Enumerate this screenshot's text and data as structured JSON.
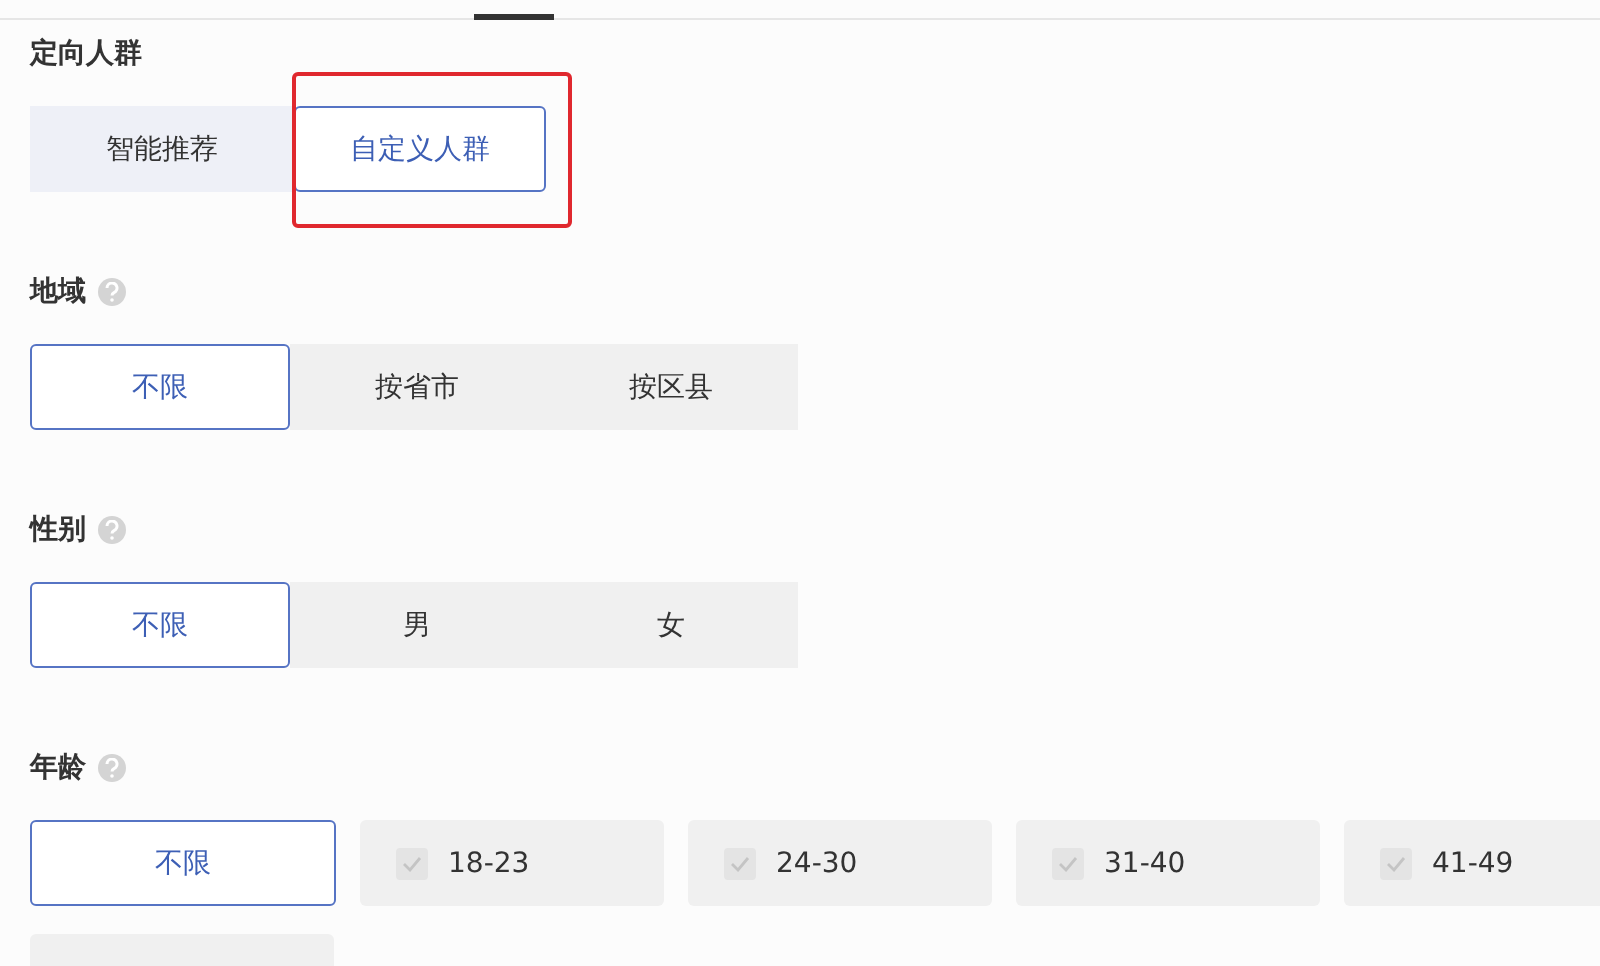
{
  "audience": {
    "label": "定向人群",
    "options": [
      {
        "label": "智能推荐",
        "selected": false
      },
      {
        "label": "自定义人群",
        "selected": true,
        "highlighted": true
      }
    ]
  },
  "region": {
    "label": "地域",
    "options": [
      {
        "label": "不限",
        "selected": true
      },
      {
        "label": "按省市",
        "selected": false
      },
      {
        "label": "按区县",
        "selected": false
      }
    ]
  },
  "gender": {
    "label": "性别",
    "options": [
      {
        "label": "不限",
        "selected": true
      },
      {
        "label": "男",
        "selected": false
      },
      {
        "label": "女",
        "selected": false
      }
    ]
  },
  "age": {
    "label": "年龄",
    "options": [
      {
        "kind": "plain",
        "label": "不限",
        "selected": true
      },
      {
        "kind": "check",
        "label": "18-23",
        "selected": false,
        "disabled": true
      },
      {
        "kind": "check",
        "label": "24-30",
        "selected": false,
        "disabled": true
      },
      {
        "kind": "check",
        "label": "31-40",
        "selected": false,
        "disabled": true
      },
      {
        "kind": "check",
        "label": "41-49",
        "selected": false,
        "disabled": true
      },
      {
        "kind": "clipped",
        "selected": false
      }
    ]
  }
}
